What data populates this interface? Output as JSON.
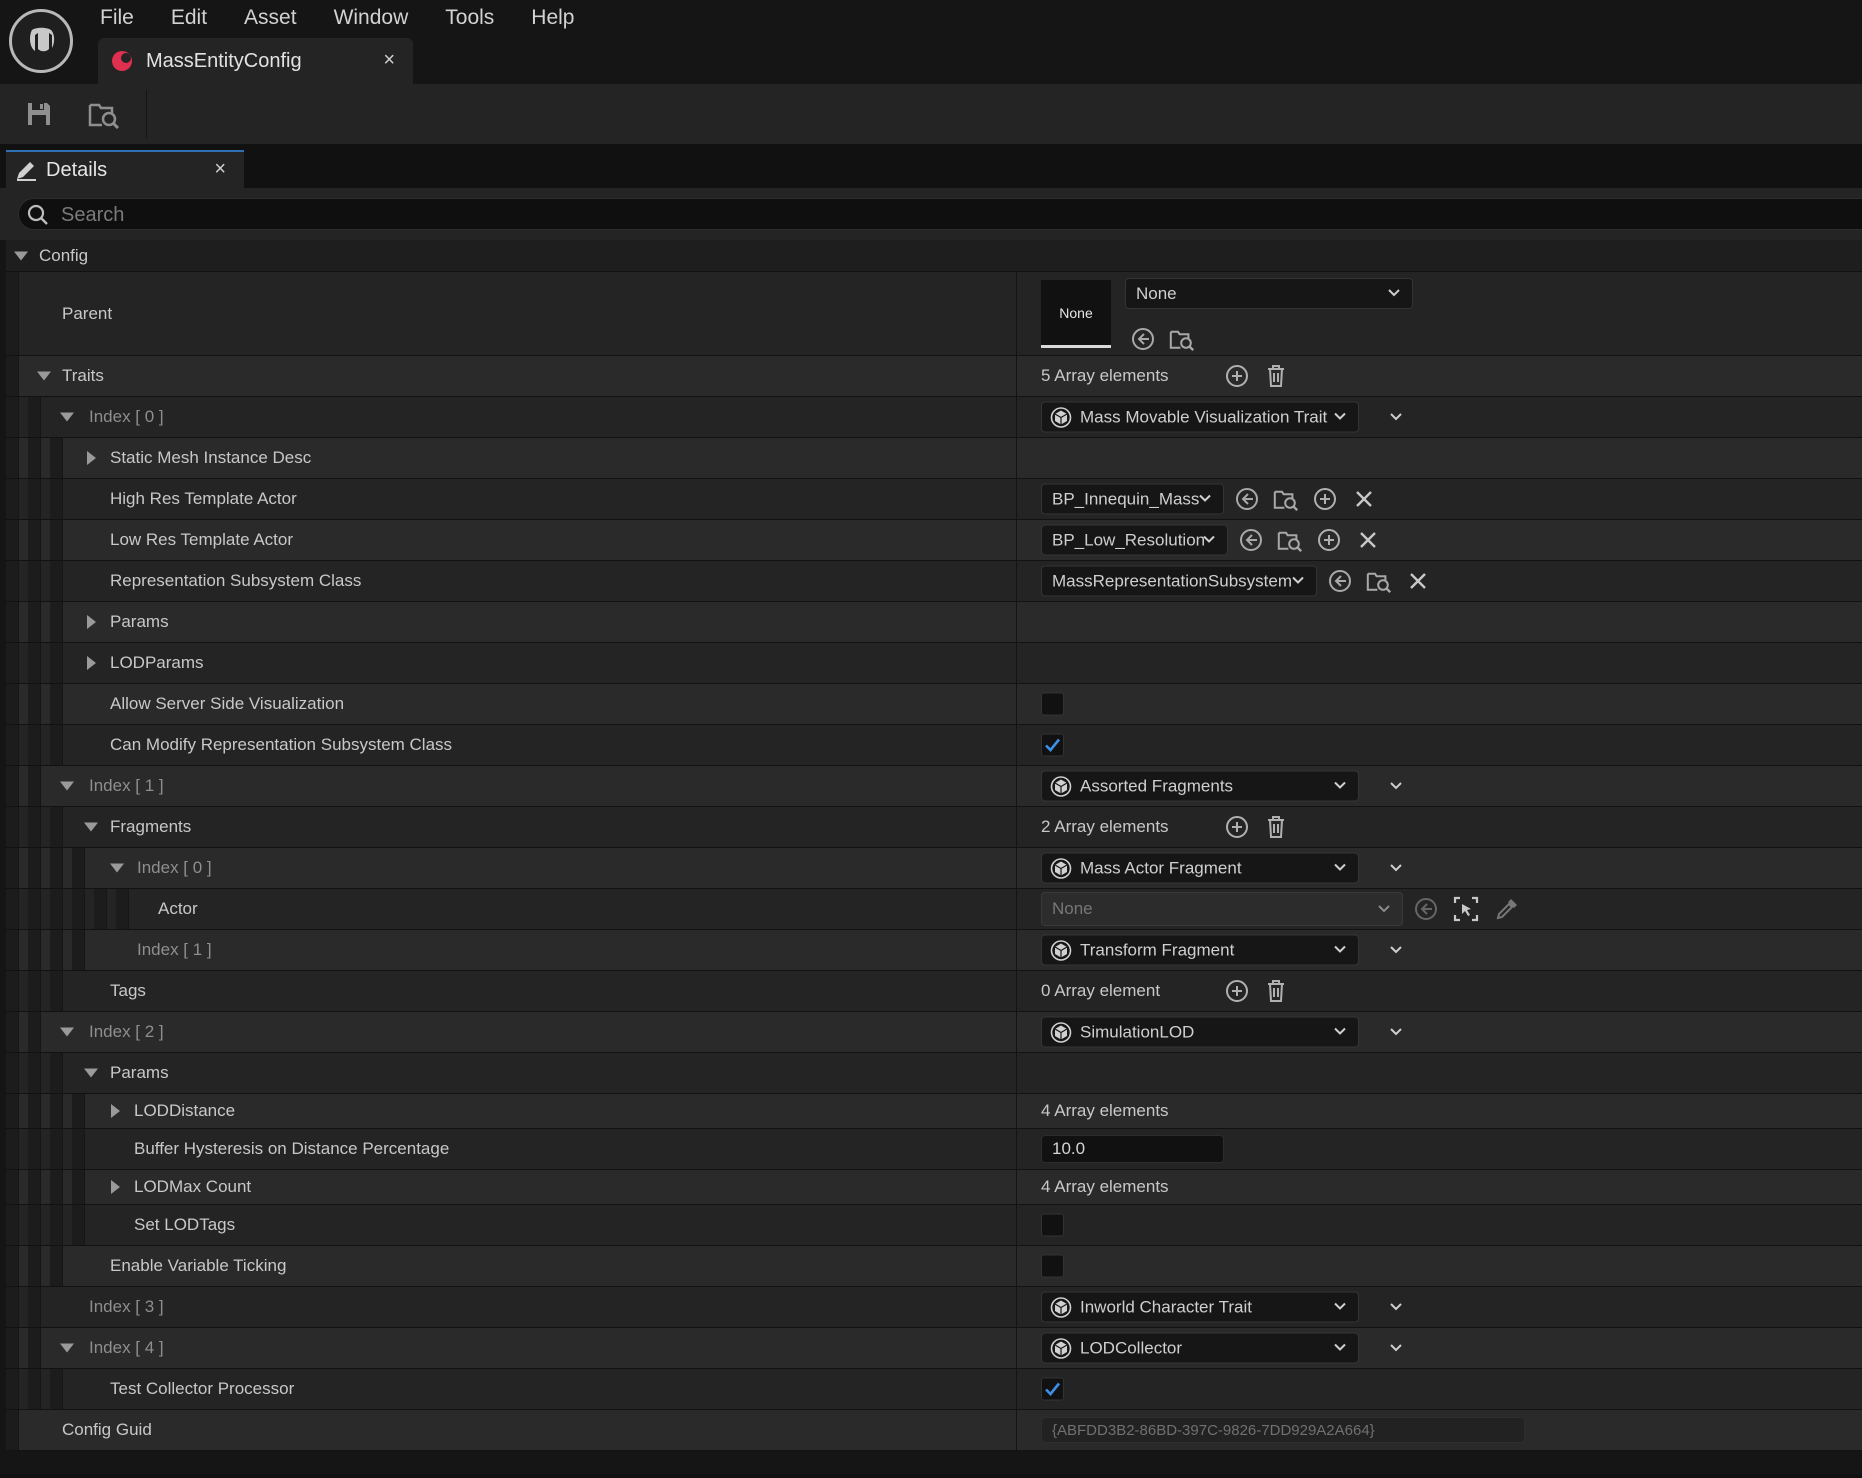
{
  "menu": [
    "File",
    "Edit",
    "Asset",
    "Window",
    "Tools",
    "Help"
  ],
  "document_tab": {
    "title": "MassEntityConfig",
    "close": "×"
  },
  "panel_tab": {
    "title": "Details",
    "close": "×"
  },
  "search": {
    "placeholder": "Search"
  },
  "category": {
    "label": "Config"
  },
  "parent": {
    "label": "Parent",
    "thumbnail": "None",
    "value": "None"
  },
  "traits": {
    "label": "Traits",
    "count": "5 Array elements"
  },
  "index0": {
    "label": "Index [ 0 ]",
    "class": "Mass Movable Visualization Trait",
    "static_mesh": "Static Mesh Instance Desc",
    "high_res_label": "High Res Template Actor",
    "high_res_value": "BP_Innequin_Mass",
    "low_res_label": "Low Res Template Actor",
    "low_res_value": "BP_Low_Resolution",
    "rep_label": "Representation Subsystem Class",
    "rep_value": "MassRepresentationSubsystem",
    "params": "Params",
    "lodparams": "LODParams",
    "allow_server": "Allow Server Side Visualization",
    "can_modify": "Can Modify Representation Subsystem Class"
  },
  "index1": {
    "label": "Index [ 1 ]",
    "class": "Assorted Fragments",
    "fragments": "Fragments",
    "fragments_count": "2 Array elements",
    "frag0_label": "Index [ 0 ]",
    "frag0_class": "Mass Actor Fragment",
    "actor_label": "Actor",
    "actor_value": "None",
    "frag1_label": "Index [ 1 ]",
    "frag1_class": "Transform Fragment",
    "tags": "Tags",
    "tags_count": "0 Array element"
  },
  "index2": {
    "label": "Index [ 2 ]",
    "class": "SimulationLOD",
    "params": "Params",
    "lod_distance": "LODDistance",
    "lod_distance_count": "4 Array elements",
    "buffer_label": "Buffer Hysteresis on Distance Percentage",
    "buffer_value": "10.0",
    "lod_max": "LODMax Count",
    "lod_max_count": "4 Array elements",
    "set_lodtags": "Set LODTags",
    "variable_ticking": "Enable Variable Ticking"
  },
  "index3": {
    "label": "Index [ 3 ]",
    "class": "Inworld Character Trait"
  },
  "index4": {
    "label": "Index [ 4 ]",
    "class": "LODCollector",
    "test_collector": "Test Collector Processor"
  },
  "config_guid": {
    "label": "Config Guid",
    "value": "{ABFDD3B2-86BD-397C-9826-7DD929A2A664}"
  },
  "checkboxes": {
    "allow_server": false,
    "can_modify": true,
    "set_lodtags": false,
    "variable_ticking": false,
    "test_collector": true
  },
  "colors": {
    "accent": "#2f6fb3",
    "check": "#3d8fe6",
    "asset_icon": "#e0304f"
  }
}
